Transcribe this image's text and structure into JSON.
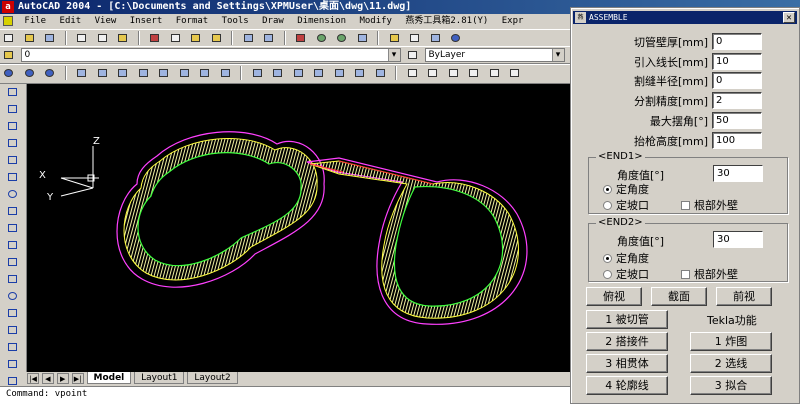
{
  "window": {
    "title": "AutoCAD 2004 - [C:\\Documents and Settings\\XPMUser\\桌面\\dwg\\11.dwg]"
  },
  "menu": [
    "File",
    "Edit",
    "View",
    "Insert",
    "Format",
    "Tools",
    "Draw",
    "Dimension",
    "Modify",
    "燕秀工具箱2.81(Y)",
    "Expr"
  ],
  "layer_toolbar": {
    "layer_value": "0",
    "linetype_value": "ByLayer"
  },
  "layout_tabs": [
    "Model",
    "Layout1",
    "Layout2"
  ],
  "command_line": "Command: vpoint",
  "ucs": {
    "x": "X",
    "y": "Y",
    "z": "Z"
  },
  "palette": {
    "title": "ASSEMBLE",
    "fields": [
      {
        "label": "切管壁厚[mm]",
        "value": "0"
      },
      {
        "label": "引入线长[mm]",
        "value": "10"
      },
      {
        "label": "割缝半径[mm]",
        "value": "0"
      },
      {
        "label": "分割精度[mm]",
        "value": "2"
      },
      {
        "label": "最大摆角[°]",
        "value": "50"
      },
      {
        "label": "抬枪高度[mm]",
        "value": "100"
      }
    ],
    "end1": {
      "title": "<END1>",
      "angle_label": "角度值[°]",
      "angle_value": "30",
      "opt_fixed_angle": "定角度",
      "opt_fixed_bevel": "定坡口",
      "opt_root_outer": "根部外壁"
    },
    "end2": {
      "title": "<END2>",
      "angle_label": "角度值[°]",
      "angle_value": "30",
      "opt_fixed_angle": "定角度",
      "opt_fixed_bevel": "定坡口",
      "opt_root_outer": "根部外壁"
    },
    "view_buttons": [
      "俯视",
      "截面",
      "前视"
    ],
    "buttons": {
      "cut_pipe": "1 被切管",
      "tekla": "Tekla功能",
      "weld_part": "2 搭接件",
      "explode": "1 炸图",
      "intersect": "3 相贯体",
      "select_line": "2 选线",
      "contour": "4 轮廓线",
      "fit": "3 拟合"
    }
  }
}
